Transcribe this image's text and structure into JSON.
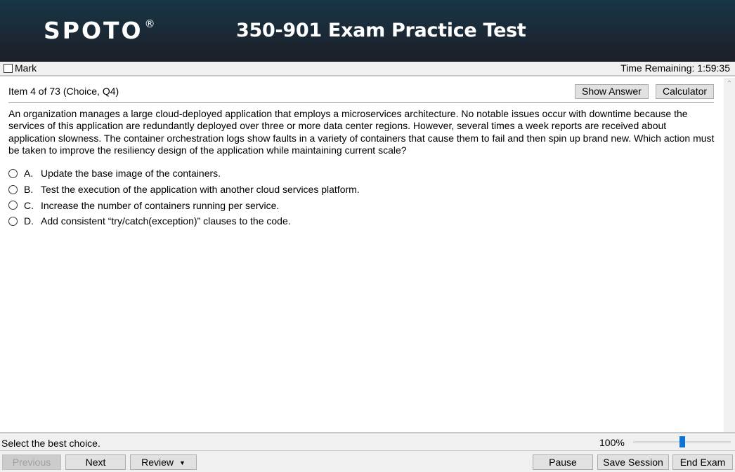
{
  "header": {
    "logo": "SPOTO",
    "logo_mark": "®",
    "title": "350-901 Exam Practice Test"
  },
  "topbar": {
    "mark_label": "Mark",
    "mark_checked": false,
    "time_remaining": "Time Remaining: 1:59:35"
  },
  "item": {
    "heading": "Item 4 of 73  (Choice, Q4)",
    "show_answer_label": "Show Answer",
    "calculator_label": "Calculator",
    "question": "An organization manages a large cloud-deployed application that employs a microservices architecture. No notable issues occur with downtime because the services of this application are redundantly deployed over three or more data center regions. However, several times a week reports are received about application slowness. The container orchestration logs show faults in a variety of containers that cause them to fail and then spin up brand new. Which action must be taken to improve the resiliency design of the application while maintaining current scale?",
    "choices": [
      {
        "letter": "A.",
        "text": "Update the base image of the containers.",
        "selected": false
      },
      {
        "letter": "B.",
        "text": "Test the execution of the application with another cloud services platform.",
        "selected": false
      },
      {
        "letter": "C.",
        "text": "Increase the number of containers running per service.",
        "selected": false
      },
      {
        "letter": "D.",
        "text": "Add consistent “try/catch(exception)” clauses to the code.",
        "selected": false
      }
    ]
  },
  "status": {
    "instruction": "Select the best choice.",
    "zoom_label": "100%",
    "zoom_slider_fraction": 0.5
  },
  "nav": {
    "previous_label": "Previous",
    "next_label": "Next",
    "review_label": "Review",
    "pause_label": "Pause",
    "save_session_label": "Save Session",
    "end_exam_label": "End Exam"
  },
  "colors": {
    "slider_thumb": "#0a74da",
    "header_top": "#173646",
    "header_bottom": "#1c1f29"
  }
}
